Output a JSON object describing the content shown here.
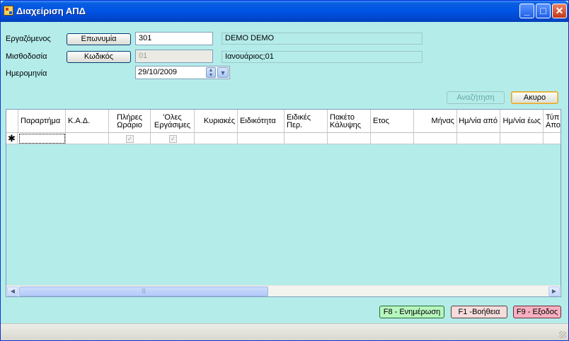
{
  "window": {
    "title": "Διαχείριση ΑΠΔ",
    "controls": {
      "minimize": "_",
      "maximize": "□",
      "close": "✕"
    }
  },
  "form": {
    "employee_label": "Εργαζόμενος",
    "name_button": "Επωνυμία",
    "employee_code": "301",
    "employee_name": "DEMO DEMO",
    "payroll_label": "Μισθοδοσία",
    "code_button": "Κωδικός",
    "payroll_code": "01",
    "payroll_period": "Ιανουάριος;01",
    "date_label": "Ημερομηνία",
    "date_value": "29/10/2009"
  },
  "actions": {
    "search": "Αναζήτηση",
    "cancel": "Ακυρο"
  },
  "grid": {
    "columns": [
      {
        "line1": "Παραρτήμα",
        "line2": ""
      },
      {
        "line1": "Κ.Α.Δ.",
        "line2": ""
      },
      {
        "line1": "Πλήρες",
        "line2": "Ωράριο"
      },
      {
        "line1": "'Ολες",
        "line2": "Εργάσιμες"
      },
      {
        "line1": "Κυριακές",
        "line2": ""
      },
      {
        "line1": "Ειδικότητα",
        "line2": ""
      },
      {
        "line1": "Ειδικές",
        "line2": "Περ."
      },
      {
        "line1": "Πακέτο",
        "line2": "Κάλυψης"
      },
      {
        "line1": "Ετος",
        "line2": ""
      },
      {
        "line1": "Μήνας",
        "line2": ""
      },
      {
        "line1": "Ημ/νία από",
        "line2": ""
      },
      {
        "line1": "Ημ/νία έως",
        "line2": ""
      },
      {
        "line1": "Τύπ",
        "line2": "Απο"
      }
    ],
    "new_row_marker": "✱",
    "check_mark": "✓",
    "scroll_left": "◀",
    "scroll_right": "▶",
    "scroll_grip": "|||"
  },
  "function_keys": {
    "f8": "F8 - Ενημέρωση",
    "f1": "F1 -Βοήθεια",
    "f9": "F9 - Εξοδος"
  },
  "colors": {
    "window_bg": "#b4ecea",
    "titlebar": "#0055e5",
    "f8_bg": "#b7f7bf",
    "f1_bg": "#f6dcdc",
    "f9_bg": "#f7b0c0"
  }
}
